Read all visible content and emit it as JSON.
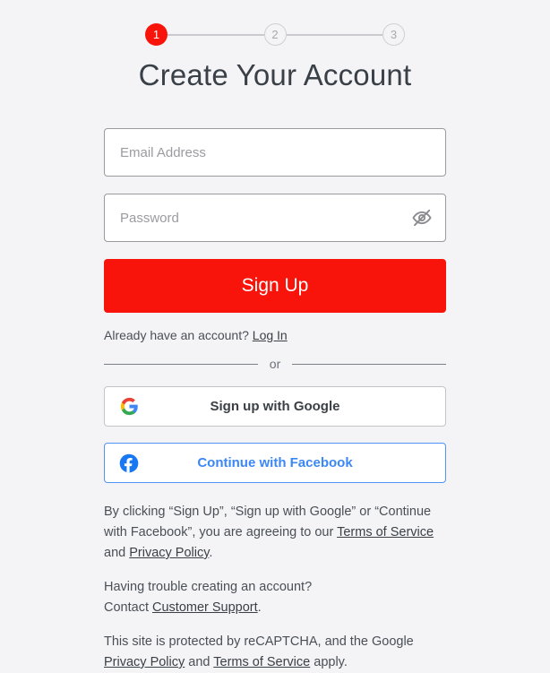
{
  "theme": {
    "background": "#f4f4f6",
    "accent_red": "#f8140b",
    "facebook_blue": "#3a87f5",
    "text": "#3b4046"
  },
  "stepper": {
    "steps": [
      {
        "label": "1",
        "state": "active"
      },
      {
        "label": "2",
        "state": "idle"
      },
      {
        "label": "3",
        "state": "idle"
      }
    ]
  },
  "header": {
    "title": "Create Your Account"
  },
  "form": {
    "email": {
      "placeholder": "Email Address",
      "value": ""
    },
    "password": {
      "placeholder": "Password",
      "value": "",
      "toggle_icon": "eye-off-icon"
    },
    "submit_label": "Sign Up"
  },
  "login_prompt": {
    "text": "Already have an account?",
    "link_label": "Log In"
  },
  "divider": {
    "label": "or"
  },
  "social": {
    "google": {
      "label": "Sign up with Google",
      "icon": "google-icon"
    },
    "facebook": {
      "label": "Continue with Facebook",
      "icon": "facebook-icon"
    }
  },
  "legal": {
    "terms_paragraph": {
      "part1": "By clicking “Sign Up”, “Sign up with Google” or “Continue with Facebook”, you are agreeing to our ",
      "terms_link": "Terms of Service",
      "part2": " and ",
      "privacy_link": "Privacy Policy",
      "part3": "."
    },
    "support_paragraph": {
      "line1": "Having trouble creating an account?",
      "line2_prefix": "Contact ",
      "support_link": "Customer Support",
      "line2_suffix": "."
    },
    "recaptcha_paragraph": {
      "part1": "This site is protected by reCAPTCHA, and the Google ",
      "privacy_link": "Privacy Policy",
      "part2": " and ",
      "terms_link": "Terms of Service",
      "part3": " apply."
    }
  }
}
